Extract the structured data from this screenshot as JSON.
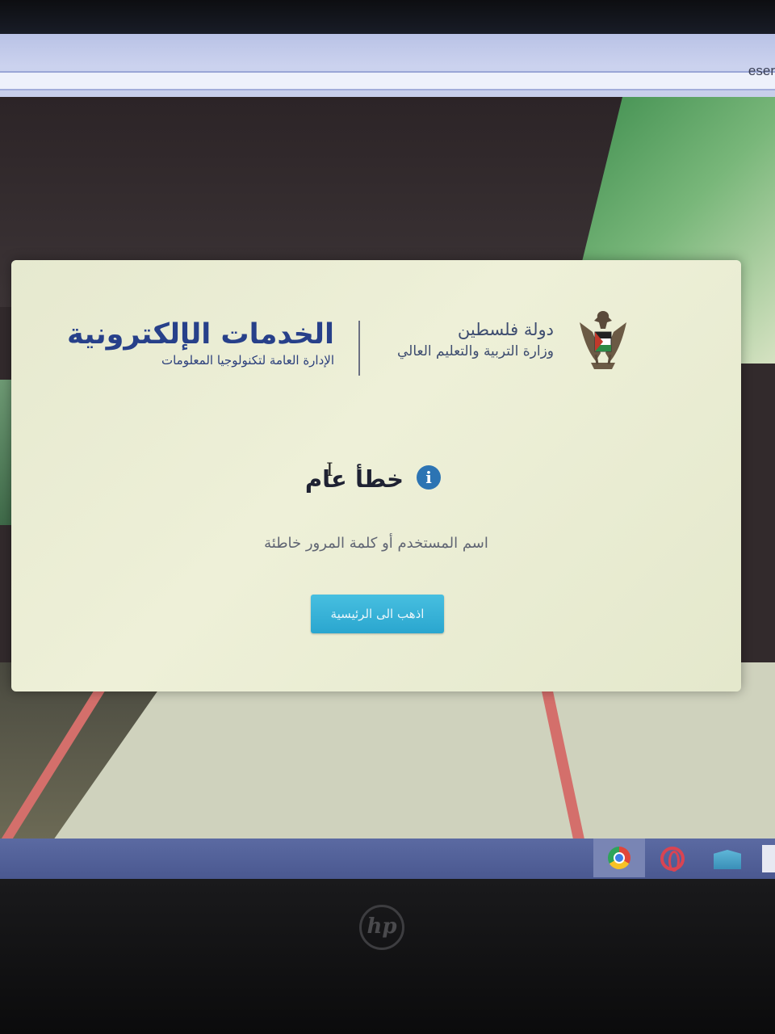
{
  "browser": {
    "address_text": "eser"
  },
  "header": {
    "state_name": "دولة فلسطين",
    "ministry_name": "وزارة التربية والتعليم العالي",
    "service_title": "الخدمات الإلكترونية",
    "service_subtitle": "الإدارة العامة لتكنولوجيا المعلومات"
  },
  "error": {
    "title": "خطأ عام",
    "message": "اسم المستخدم أو كلمة المرور خاطئة",
    "info_icon_glyph": "i"
  },
  "actions": {
    "home_button_label": "اذهب الى الرئيسية"
  },
  "taskbar": {
    "icons": [
      "chrome-icon",
      "opera-icon",
      "mail-icon"
    ]
  },
  "device": {
    "brand_logo": "hp"
  },
  "colors": {
    "brand_blue": "#27408a",
    "button": "#2aa6cf",
    "info_icon": "#2c74b3"
  }
}
